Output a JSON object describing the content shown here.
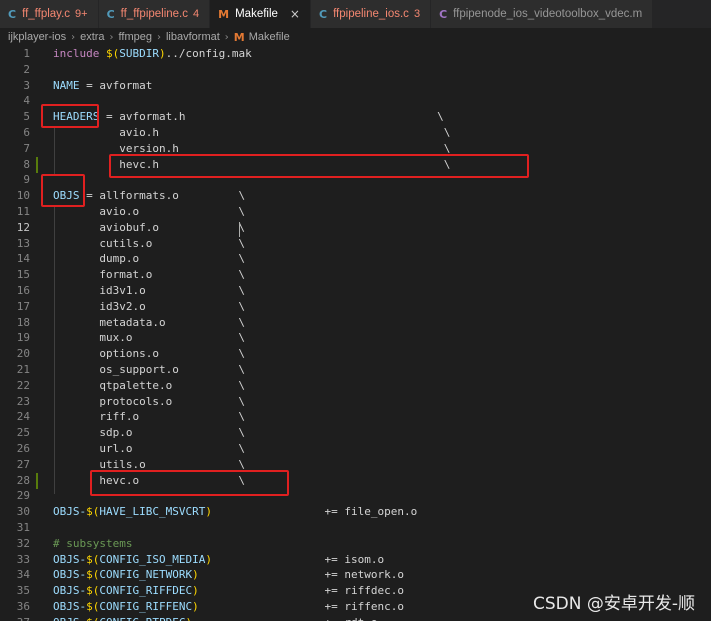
{
  "tabs": [
    {
      "icon": "C",
      "icon_kind": "c",
      "label": "ff_ffplay.c",
      "badge": "9+",
      "error": true,
      "active": false
    },
    {
      "icon": "C",
      "icon_kind": "c",
      "label": "ff_ffpipeline.c",
      "badge": "4",
      "error": true,
      "active": false
    },
    {
      "icon": "M",
      "icon_kind": "m",
      "label": "Makefile",
      "badge": "",
      "error": false,
      "active": true
    },
    {
      "icon": "C",
      "icon_kind": "c",
      "label": "ffpipeline_ios.c",
      "badge": "3",
      "error": true,
      "active": false
    },
    {
      "icon": "C",
      "icon_kind": "obj",
      "label": "ffpipenode_ios_videotoolbox_vdec.m",
      "badge": "",
      "error": false,
      "active": false
    }
  ],
  "close_glyph": "×",
  "breadcrumb": [
    "ijkplayer-ios",
    "extra",
    "ffmpeg",
    "libavformat",
    "Makefile"
  ],
  "breadcrumb_file_icon": "M",
  "editor": {
    "lines": [
      {
        "n": 1,
        "tokens": [
          [
            "kw",
            "include "
          ],
          [
            "var",
            "$("
          ],
          [
            "var",
            "SUBDIR"
          ],
          [
            "var",
            ")"
          ],
          [
            "str",
            "../config.mak"
          ]
        ]
      },
      {
        "n": 2,
        "tokens": []
      },
      {
        "n": 3,
        "tokens": [
          [
            "var",
            "NAME"
          ],
          [
            "str",
            " = avformat"
          ]
        ]
      },
      {
        "n": 4,
        "tokens": []
      },
      {
        "n": 5,
        "tokens": [
          [
            "var",
            "HEADERS"
          ],
          [
            "str",
            " = avformat.h                                      \\"
          ]
        ]
      },
      {
        "n": 6,
        "tokens": [
          [
            "str",
            "          avio.h                                           \\"
          ]
        ]
      },
      {
        "n": 7,
        "tokens": [
          [
            "str",
            "          version.h                                        \\"
          ]
        ]
      },
      {
        "n": 8,
        "tokens": [
          [
            "str",
            "          hevc.h                                           \\"
          ]
        ],
        "modified": true
      },
      {
        "n": 9,
        "tokens": []
      },
      {
        "n": 10,
        "tokens": [
          [
            "var",
            "OBJS"
          ],
          [
            "str",
            " = allformats.o         \\"
          ]
        ]
      },
      {
        "n": 11,
        "tokens": [
          [
            "str",
            "       avio.o               \\"
          ]
        ]
      },
      {
        "n": 12,
        "tokens": [
          [
            "str",
            "       aviobuf.o            \\"
          ]
        ],
        "current": true
      },
      {
        "n": 13,
        "tokens": [
          [
            "str",
            "       cutils.o             \\"
          ]
        ]
      },
      {
        "n": 14,
        "tokens": [
          [
            "str",
            "       dump.o               \\"
          ]
        ]
      },
      {
        "n": 15,
        "tokens": [
          [
            "str",
            "       format.o             \\"
          ]
        ]
      },
      {
        "n": 16,
        "tokens": [
          [
            "str",
            "       id3v1.o              \\"
          ]
        ]
      },
      {
        "n": 17,
        "tokens": [
          [
            "str",
            "       id3v2.o              \\"
          ]
        ]
      },
      {
        "n": 18,
        "tokens": [
          [
            "str",
            "       metadata.o           \\"
          ]
        ]
      },
      {
        "n": 19,
        "tokens": [
          [
            "str",
            "       mux.o                \\"
          ]
        ]
      },
      {
        "n": 20,
        "tokens": [
          [
            "str",
            "       options.o            \\"
          ]
        ]
      },
      {
        "n": 21,
        "tokens": [
          [
            "str",
            "       os_support.o         \\"
          ]
        ]
      },
      {
        "n": 22,
        "tokens": [
          [
            "str",
            "       qtpalette.o          \\"
          ]
        ]
      },
      {
        "n": 23,
        "tokens": [
          [
            "str",
            "       protocols.o          \\"
          ]
        ]
      },
      {
        "n": 24,
        "tokens": [
          [
            "str",
            "       riff.o               \\"
          ]
        ]
      },
      {
        "n": 25,
        "tokens": [
          [
            "str",
            "       sdp.o                \\"
          ]
        ]
      },
      {
        "n": 26,
        "tokens": [
          [
            "str",
            "       url.o                \\"
          ]
        ]
      },
      {
        "n": 27,
        "tokens": [
          [
            "str",
            "       utils.o              \\"
          ]
        ]
      },
      {
        "n": 28,
        "tokens": [
          [
            "str",
            "       hevc.o               \\"
          ]
        ],
        "modified": true
      },
      {
        "n": 29,
        "tokens": []
      },
      {
        "n": 30,
        "tokens": [
          [
            "var",
            "OBJS-"
          ],
          [
            "var",
            "$("
          ],
          [
            "var",
            "HAVE_LIBC_MSVCRT"
          ],
          [
            "var",
            ")"
          ],
          [
            "str",
            "                 += file_open.o"
          ]
        ]
      },
      {
        "n": 31,
        "tokens": []
      },
      {
        "n": 32,
        "tokens": [
          [
            "comment",
            "# subsystems"
          ]
        ]
      },
      {
        "n": 33,
        "tokens": [
          [
            "var",
            "OBJS-"
          ],
          [
            "var",
            "$("
          ],
          [
            "var",
            "CONFIG_ISO_MEDIA"
          ],
          [
            "var",
            ")"
          ],
          [
            "str",
            "                 += isom.o"
          ]
        ]
      },
      {
        "n": 34,
        "tokens": [
          [
            "var",
            "OBJS-"
          ],
          [
            "var",
            "$("
          ],
          [
            "var",
            "CONFIG_NETWORK"
          ],
          [
            "var",
            ")"
          ],
          [
            "str",
            "                   += network.o"
          ]
        ]
      },
      {
        "n": 35,
        "tokens": [
          [
            "var",
            "OBJS-"
          ],
          [
            "var",
            "$("
          ],
          [
            "var",
            "CONFIG_RIFFDEC"
          ],
          [
            "var",
            ")"
          ],
          [
            "str",
            "                   += riffdec.o"
          ]
        ]
      },
      {
        "n": 36,
        "tokens": [
          [
            "var",
            "OBJS-"
          ],
          [
            "var",
            "$("
          ],
          [
            "var",
            "CONFIG_RIFFENC"
          ],
          [
            "var",
            ")"
          ],
          [
            "str",
            "                   += riffenc.o"
          ]
        ]
      },
      {
        "n": 37,
        "tokens": [
          [
            "var",
            "OBJS-"
          ],
          [
            "var",
            "$("
          ],
          [
            "var",
            "CONFIG_RTPDEC"
          ],
          [
            "var",
            ")"
          ],
          [
            "str",
            "                    += rdt.o"
          ]
        ]
      }
    ]
  },
  "watermark": "CSDN @安卓开发-顺",
  "colors": {
    "annotation_red": "#e02020",
    "background": "#1e1e1e"
  }
}
